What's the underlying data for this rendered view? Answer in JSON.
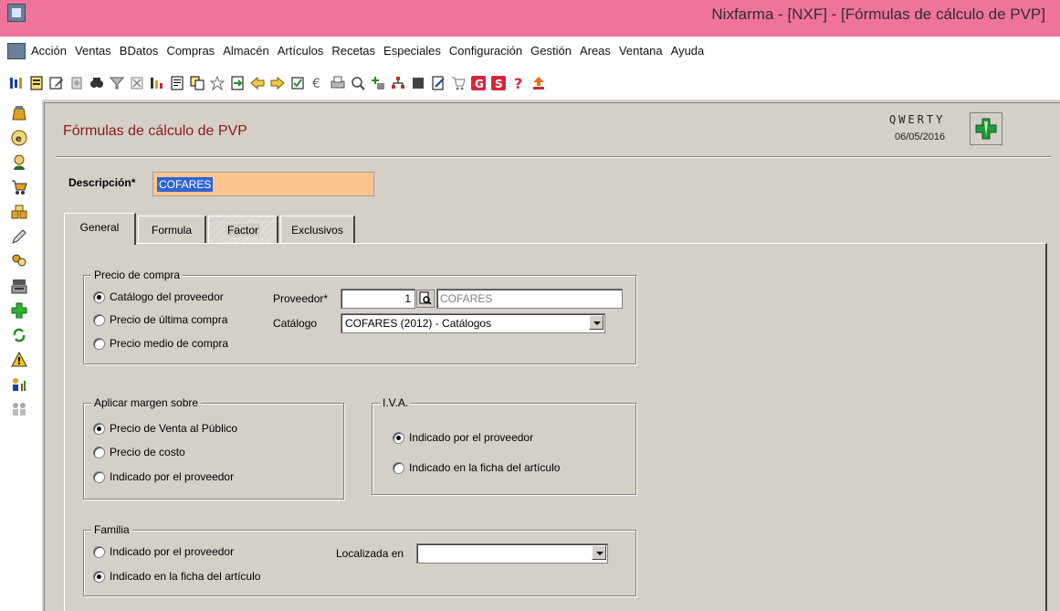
{
  "titlebar": {
    "title": "Nixfarma - [NXF] - [Fórmulas de cálculo de PVP]"
  },
  "menu": [
    "Acción",
    "Ventas",
    "BDatos",
    "Compras",
    "Almacén",
    "Artículos",
    "Recetas",
    "Especiales",
    "Configuración",
    "Gestión",
    "Areas",
    "Ventana",
    "Ayuda"
  ],
  "window": {
    "title": "Fórmulas de cálculo de PVP",
    "user": "QWERTY",
    "date": "06/05/2016"
  },
  "descripcion": {
    "label": "Descripción*",
    "value": "COFARES"
  },
  "tabs": [
    "General",
    "Formula",
    "Factor",
    "Exclusivos"
  ],
  "precio_compra": {
    "title": "Precio de compra",
    "options": [
      "Catálogo del proveedor",
      "Precio de última compra",
      "Precio medio de compra"
    ],
    "selected": 0,
    "proveedor_label": "Proveedor*",
    "proveedor_code": "1",
    "proveedor_name": "COFARES",
    "catalogo_label": "Catálogo",
    "catalogo_value": "COFARES (2012) - Catálogos"
  },
  "aplicar_margen": {
    "title": "Aplicar margen sobre",
    "options": [
      "Precio de Venta al Público",
      "Precio de costo",
      "Indicado por el proveedor"
    ],
    "selected": 0
  },
  "iva": {
    "title": "I.V.A.",
    "options": [
      "Indicado por el proveedor",
      "Indicado en la ficha del artículo"
    ],
    "selected": 0
  },
  "familia": {
    "title": "Familia",
    "options": [
      "Indicado por el proveedor",
      "Indicado en la ficha del artículo"
    ],
    "selected": 1,
    "localizada_label": "Localizada en",
    "localizada_value": ""
  },
  "colors": {
    "titlebar": "#f0739a",
    "window_title": "#8b1a1a",
    "desc_field": "#fcc58d",
    "selection": "#2f64d6"
  }
}
